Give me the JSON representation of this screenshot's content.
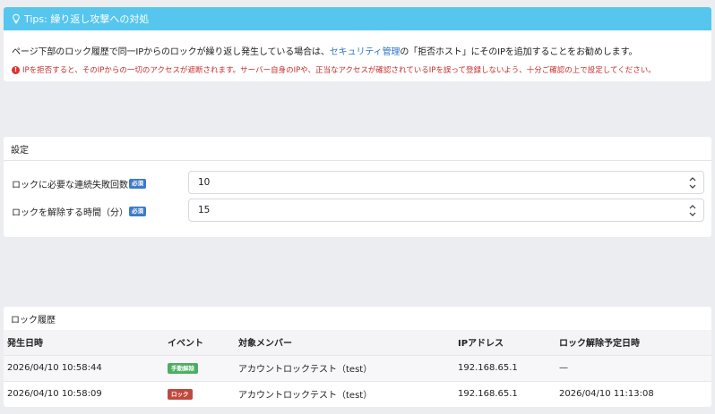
{
  "tips": {
    "title": "Tips: 繰り返し攻撃への対処",
    "line1_before": "ページ下部のロック履歴で同一IPからのロックが繰り返し発生している場合は、",
    "line1_link": "セキュリティ管理",
    "line1_after": "の「拒否ホスト」にそのIPを追加することをお勧めします。",
    "warning_icon": "!",
    "warning": "IPを拒否すると、そのIPからの一切のアクセスが遮断されます。サーバー自身のIPや、正当なアクセスが確認されているIPを誤って登録しないよう、十分ご確認の上で設定してください。"
  },
  "settings": {
    "title": "設定",
    "required_label": "必須",
    "fields": [
      {
        "label": "ロックに必要な連続失敗回数",
        "value": "10"
      },
      {
        "label": "ロックを解除する時間（分）",
        "value": "15"
      }
    ]
  },
  "history": {
    "title": "ロック履歴",
    "columns": [
      "発生日時",
      "イベント",
      "対象メンバー",
      "IPアドレス",
      "ロック解除予定日時"
    ],
    "rows": [
      {
        "datetime": "2026/04/10 10:58:44",
        "event": "手動解除",
        "event_color": "#4cae62",
        "member": "アカウントロックテスト（test）",
        "ip": "192.168.65.1",
        "unlock": "—"
      },
      {
        "datetime": "2026/04/10 10:58:09",
        "event": "ロック",
        "event_color": "#c0493f",
        "member": "アカウントロックテスト（test）",
        "ip": "192.168.65.1",
        "unlock": "2026/04/10 11:13:08"
      }
    ]
  },
  "colors": {
    "tips_header": "#56c6ee",
    "link": "#2a74c9",
    "warning": "#c62d2d",
    "required_badge": "#3d7ac6"
  },
  "icons": {
    "tips": "lightbulb-icon",
    "warning": "exclamation-circle-icon",
    "stepper": "up-down-chevron-icon"
  }
}
